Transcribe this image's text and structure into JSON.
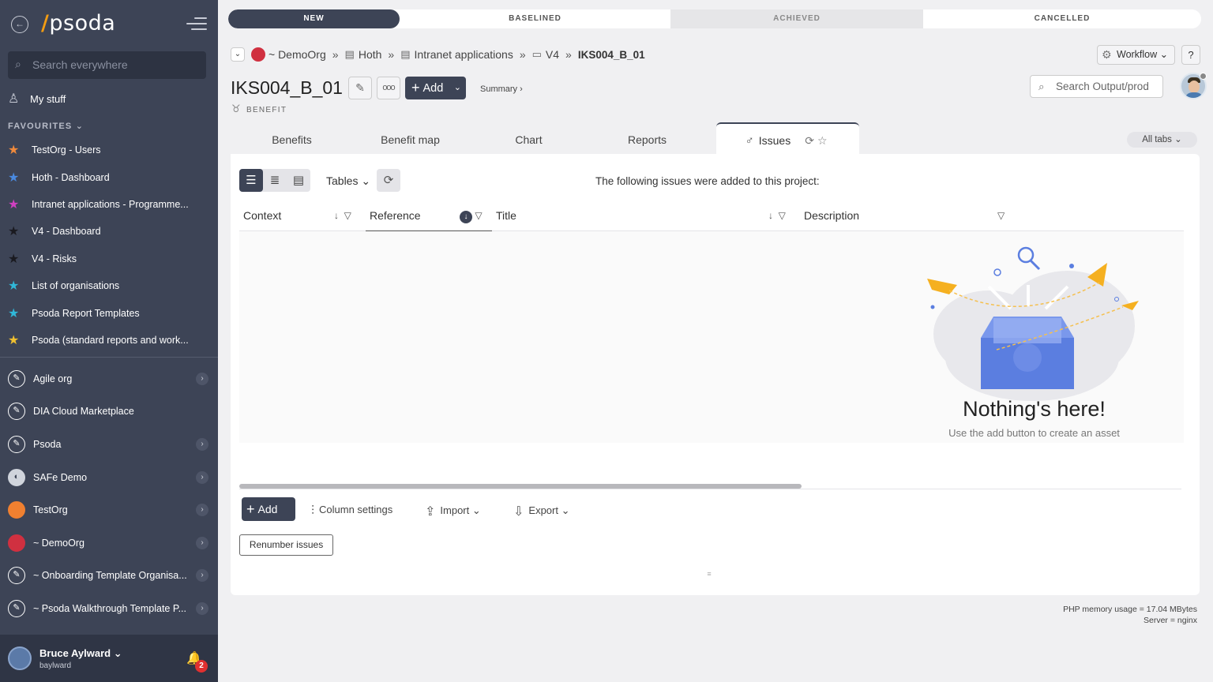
{
  "sidebar": {
    "logo": "psoda",
    "search_placeholder": "Search everywhere",
    "my_stuff": "My stuff",
    "favourites_heading": "FAVOURITES",
    "favourites": [
      {
        "label": "TestOrg - Users",
        "color": "#f08a3c"
      },
      {
        "label": "Hoth - Dashboard",
        "color": "#4a8ae0"
      },
      {
        "label": "Intranet applications - Programme...",
        "color": "#d040c0"
      },
      {
        "label": "V4 - Dashboard",
        "color": "#2a2a30"
      },
      {
        "label": "V4 - Risks",
        "color": "#2a2a30"
      },
      {
        "label": "List of organisations",
        "color": "#30b8d8"
      },
      {
        "label": "Psoda Report Templates",
        "color": "#30b8d8"
      },
      {
        "label": "Psoda (standard reports and work...",
        "color": "#f0c030"
      }
    ],
    "organisations": [
      {
        "label": "Agile org",
        "icon": "pen-icon",
        "has_children": true
      },
      {
        "label": "DIA Cloud Marketplace",
        "icon": "pen-icon",
        "has_children": false
      },
      {
        "label": "Psoda",
        "icon": "pen-icon",
        "has_children": true
      },
      {
        "label": "SAFe Demo",
        "icon": "globe-icon",
        "has_children": true
      },
      {
        "label": "TestOrg",
        "icon": "orange-circle",
        "has_children": true
      },
      {
        "label": "~ DemoOrg",
        "icon": "red-circle",
        "has_children": true
      },
      {
        "label": "~ Onboarding Template Organisa...",
        "icon": "pen-icon",
        "has_children": true
      },
      {
        "label": "~ Psoda Walkthrough Template P...",
        "icon": "pen-icon",
        "has_children": true
      }
    ],
    "user": {
      "name": "Bruce Aylward",
      "login": "baylward",
      "notifications": "2"
    }
  },
  "status_bar": [
    "NEW",
    "BASELINED",
    "ACHIEVED",
    "CANCELLED"
  ],
  "breadcrumb": {
    "org": "~ DemoOrg",
    "items": [
      "Hoth",
      "Intranet applications",
      "V4"
    ],
    "current": "IKS004_B_01"
  },
  "header": {
    "workflow": "Workflow",
    "help": "?",
    "title": "IKS004_B_01",
    "add": "Add",
    "summary": "Summary ›",
    "type": "BENEFIT",
    "search_placeholder": "Search Output/prod"
  },
  "tabs": [
    "Benefits",
    "Benefit map",
    "Chart",
    "Reports",
    "Issues"
  ],
  "all_tabs": "All tabs",
  "panel": {
    "tables": "Tables",
    "caption": "The following issues were added to this project:",
    "columns": [
      "Context",
      "Reference",
      "Title",
      "Description"
    ],
    "empty_title": "Nothing's here!",
    "empty_sub": "Use the add button to create an asset",
    "add": "Add",
    "column_settings": "Column settings",
    "import": "Import",
    "export": "Export",
    "renumber": "Renumber issues"
  },
  "footer": {
    "memory": "PHP memory usage = 17.04 MBytes",
    "server": "Server = nginx"
  }
}
